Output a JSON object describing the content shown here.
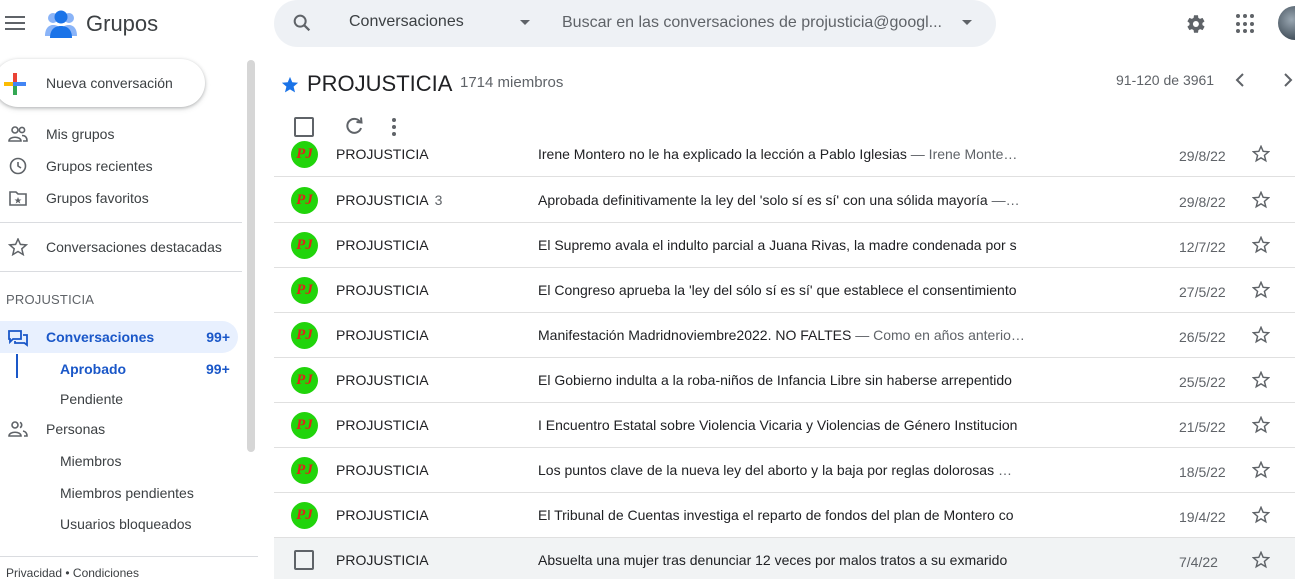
{
  "header": {
    "app_title": "Grupos",
    "search_scope": "Conversaciones",
    "search_placeholder": "Buscar en las conversaciones de projusticia@googl..."
  },
  "sidebar": {
    "new_conversation": "Nueva conversación",
    "items": [
      {
        "label": "Mis grupos",
        "icon": "people-icon"
      },
      {
        "label": "Grupos recientes",
        "icon": "clock-icon"
      },
      {
        "label": "Grupos favoritos",
        "icon": "folder-star-icon"
      },
      {
        "label": "Conversaciones destacadas",
        "icon": "star-outline-icon"
      }
    ],
    "group_section": "PROJUSTICIA",
    "conversations": {
      "label": "Conversaciones",
      "count": "99+"
    },
    "approved": {
      "label": "Aprobado",
      "count": "99+"
    },
    "pending": "Pendiente",
    "people": "Personas",
    "members": "Miembros",
    "pending_members": "Miembros pendientes",
    "blocked_users": "Usuarios bloqueados",
    "footer": "Privacidad • Condiciones"
  },
  "main": {
    "group_name": "PROJUSTICIA",
    "member_count": "1714 miembros",
    "pagination": "91-120 de 3961"
  },
  "rows": [
    {
      "sender": "PROJUSTICIA",
      "count": "",
      "subject": "Irene Montero no le ha explicado la lección a Pablo Iglesias",
      "snippet": " — Irene Monte…",
      "date": "29/8/22"
    },
    {
      "sender": "PROJUSTICIA",
      "count": "3",
      "subject": "Aprobada definitivamente la ley del 'solo sí es sí' con una sólida mayoría",
      "snippet": " —…",
      "date": "29/8/22"
    },
    {
      "sender": "PROJUSTICIA",
      "count": "",
      "subject": "El Supremo avala el indulto parcial a Juana Rivas, la madre condenada por s",
      "snippet": "",
      "date": "12/7/22"
    },
    {
      "sender": "PROJUSTICIA",
      "count": "",
      "subject": "El Congreso aprueba la 'ley del sólo sí es sí' que establece el consentimiento",
      "snippet": "",
      "date": "27/5/22"
    },
    {
      "sender": "PROJUSTICIA",
      "count": "",
      "subject": "Manifestación Madridnoviembre2022. NO FALTES",
      "snippet": " — Como en años anterio…",
      "date": "26/5/22"
    },
    {
      "sender": "PROJUSTICIA",
      "count": "",
      "subject": "El Gobierno indulta a la roba-niños de Infancia Libre sin haberse arrepentido",
      "snippet": "",
      "date": "25/5/22"
    },
    {
      "sender": "PROJUSTICIA",
      "count": "",
      "subject": "I Encuentro Estatal sobre Violencia Vicaria y Violencias de Género Institucion",
      "snippet": "",
      "date": "21/5/22"
    },
    {
      "sender": "PROJUSTICIA",
      "count": "",
      "subject": "Los puntos clave de la nueva ley del aborto y la baja por reglas dolorosas",
      "snippet": " …",
      "date": "18/5/22"
    },
    {
      "sender": "PROJUSTICIA",
      "count": "",
      "subject": "El Tribunal de Cuentas investiga el reparto de fondos del plan de Montero co",
      "snippet": "",
      "date": "19/4/22"
    },
    {
      "sender": "PROJUSTICIA",
      "count": "",
      "subject": "Absuelta una mujer tras denunciar 12 veces por malos tratos a su exmarido",
      "snippet": "",
      "date": "7/4/22"
    }
  ],
  "avatar_text": "PJ",
  "colors": {
    "accent": "#1a57c8",
    "avatar_bg": "#21d40b",
    "avatar_text": "#e0221b",
    "star_blue": "#1a73e8"
  }
}
